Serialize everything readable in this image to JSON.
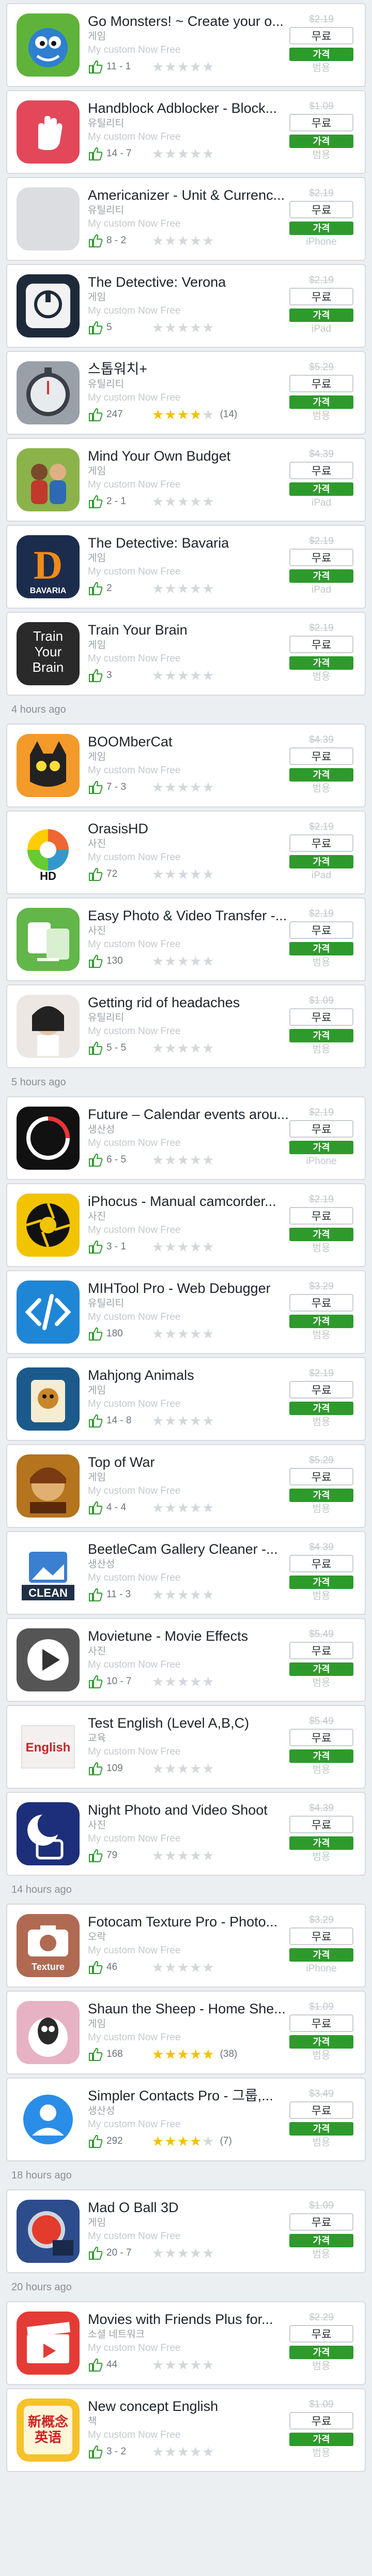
{
  "colors": {
    "accent_green": "#2e9a2c",
    "star_on": "#f2c200",
    "star_off": "#d4d7db"
  },
  "common": {
    "custom_label": "My custom Now Free",
    "free_label": "무료",
    "price_label": "가격"
  },
  "sections": [
    {
      "header": "",
      "apps": [
        {
          "title": "Go Monsters! ~ Create your o...",
          "category": "게임",
          "old_price": "$2.19",
          "likes": "11 - 1",
          "rating": 0,
          "rating_count": "",
          "device": "범용",
          "icon": "monster-icon",
          "icon_color": "#5fb33a"
        },
        {
          "title": "Handblock Adblocker - Block...",
          "category": "유틸리티",
          "old_price": "$1.09",
          "likes": "14 - 7",
          "rating": 0,
          "rating_count": "",
          "device": "범용",
          "icon": "hand-icon",
          "icon_color": "#e2485a"
        },
        {
          "title": "Americanizer - Unit & Currenc...",
          "category": "유틸리티",
          "old_price": "$2.19",
          "likes": "8 - 2",
          "rating": 0,
          "rating_count": "",
          "device": "iPhone",
          "icon": "placeholder-icon",
          "icon_color": "#dcdde0"
        },
        {
          "title": "The Detective: Verona",
          "category": "게임",
          "old_price": "$2.19",
          "likes": "5",
          "rating": 0,
          "rating_count": "",
          "device": "iPad",
          "icon": "detective-icon",
          "icon_color": "#1e2a3a"
        },
        {
          "title": "스톱워치+",
          "category": "유틸리티",
          "old_price": "$5.29",
          "likes": "247",
          "rating": 4,
          "rating_count": "(14)",
          "device": "범용",
          "icon": "stopwatch-icon",
          "icon_color": "#3a3f47"
        },
        {
          "title": "Mind Your Own Budget",
          "category": "게임",
          "old_price": "$4.39",
          "likes": "2 - 1",
          "rating": 0,
          "rating_count": "",
          "device": "iPad",
          "icon": "people-icon",
          "icon_color": "#8bb34a"
        },
        {
          "title": "The Detective: Bavaria",
          "category": "게임",
          "old_price": "$2.19",
          "likes": "2",
          "rating": 0,
          "rating_count": "",
          "device": "iPad",
          "icon": "detective-d-icon",
          "icon_color": "#1c2c4c"
        },
        {
          "title": "Train Your Brain",
          "category": "게임",
          "old_price": "$2.19",
          "likes": "3",
          "rating": 0,
          "rating_count": "",
          "device": "범용",
          "icon": "brain-text-icon",
          "icon_color": "#2a2a2a",
          "icon_text": "Train\nYour\nBrain"
        }
      ]
    },
    {
      "header": "4 hours ago",
      "apps": [
        {
          "title": "BOOMberCat",
          "category": "게임",
          "old_price": "$4.39",
          "likes": "7 - 3",
          "rating": 0,
          "rating_count": "",
          "device": "범용",
          "icon": "cat-icon",
          "icon_color": "#f39a2a"
        },
        {
          "title": "OrasisHD",
          "category": "사진",
          "old_price": "$2.19",
          "likes": "72",
          "rating": 0,
          "rating_count": "",
          "device": "iPad",
          "icon": "orasis-icon",
          "icon_color": "#ffffff",
          "icon_text": "HD"
        },
        {
          "title": "Easy Photo & Video Transfer -...",
          "category": "사진",
          "old_price": "$2.19",
          "likes": "130",
          "rating": 0,
          "rating_count": "",
          "device": "범용",
          "icon": "transfer-icon",
          "icon_color": "#62b64a"
        },
        {
          "title": "Getting rid of headaches",
          "category": "유틸리티",
          "old_price": "$1.09",
          "likes": "5 - 5",
          "rating": 0,
          "rating_count": "",
          "device": "범용",
          "icon": "headache-icon",
          "icon_color": "#c9b8a8"
        }
      ]
    },
    {
      "header": "5 hours ago",
      "apps": [
        {
          "title": "Future – Calendar events arou...",
          "category": "생산성",
          "old_price": "$2.19",
          "likes": "6 - 5",
          "rating": 0,
          "rating_count": "",
          "device": "iPhone",
          "icon": "future-icon",
          "icon_color": "#111111"
        },
        {
          "title": "iPhocus - Manual camcorder...",
          "category": "사진",
          "old_price": "$2.19",
          "likes": "3 - 1",
          "rating": 0,
          "rating_count": "",
          "device": "범용",
          "icon": "aperture-icon",
          "icon_color": "#f2c400"
        },
        {
          "title": "MIHTool Pro - Web Debugger",
          "category": "유틸리티",
          "old_price": "$3.29",
          "likes": "180",
          "rating": 0,
          "rating_count": "",
          "device": "범용",
          "icon": "code-icon",
          "icon_color": "#1f86d6"
        },
        {
          "title": "Mahjong Animals",
          "category": "게임",
          "old_price": "$2.19",
          "likes": "14 - 8",
          "rating": 0,
          "rating_count": "",
          "device": "범용",
          "icon": "mahjong-icon",
          "icon_color": "#1c5a8c"
        },
        {
          "title": "Top of War",
          "category": "게임",
          "old_price": "$5.29",
          "likes": "4 - 4",
          "rating": 0,
          "rating_count": "",
          "device": "범용",
          "icon": "warrior-icon",
          "icon_color": "#b5741e"
        },
        {
          "title": "BeetleCam Gallery Cleaner -...",
          "category": "생산성",
          "old_price": "$4.39",
          "likes": "11 - 3",
          "rating": 0,
          "rating_count": "",
          "device": "범용",
          "icon": "clean-icon",
          "icon_color": "#ffffff",
          "icon_text": "CLEAN"
        },
        {
          "title": "Movietune - Movie Effects",
          "category": "사진",
          "old_price": "$5.49",
          "likes": "10 - 7",
          "rating": 0,
          "rating_count": "",
          "device": "범용",
          "icon": "play-icon",
          "icon_color": "#555555"
        },
        {
          "title": "Test English (Level A,B,C)",
          "category": "교육",
          "old_price": "$5.49",
          "likes": "109",
          "rating": 0,
          "rating_count": "",
          "device": "범용",
          "icon": "english-icon",
          "icon_color": "#ffffff",
          "icon_text": "English"
        },
        {
          "title": "Night Photo and Video Shoot",
          "category": "사진",
          "old_price": "$4.39",
          "likes": "79",
          "rating": 0,
          "rating_count": "",
          "device": "범용",
          "icon": "night-icon",
          "icon_color": "#1d2f7a"
        }
      ]
    },
    {
      "header": "14 hours ago",
      "apps": [
        {
          "title": "Fotocam Texture Pro - Photo...",
          "category": "오락",
          "old_price": "$3.29",
          "likes": "46",
          "rating": 0,
          "rating_count": "",
          "device": "iPhone",
          "icon": "camera-icon",
          "icon_color": "#b06a52",
          "icon_text": "Texture"
        },
        {
          "title": "Shaun the Sheep - Home She...",
          "category": "게임",
          "old_price": "$1.09",
          "likes": "168",
          "rating": 5,
          "rating_count": "(38)",
          "device": "범용",
          "icon": "sheep-icon",
          "icon_color": "#e7b2c4"
        },
        {
          "title": "Simpler Contacts Pro - 그룹,...",
          "category": "생산성",
          "old_price": "$3.49",
          "likes": "292",
          "rating": 4,
          "rating_count": "(7)",
          "device": "범용",
          "icon": "contact-icon",
          "icon_color": "#2a8de8"
        }
      ]
    },
    {
      "header": "18 hours ago",
      "apps": [
        {
          "title": "Mad O Ball 3D",
          "category": "게임",
          "old_price": "$1.09",
          "likes": "20 - 7",
          "rating": 0,
          "rating_count": "",
          "device": "범용",
          "icon": "ball-icon",
          "icon_color": "#2d4c8c"
        }
      ]
    },
    {
      "header": "20 hours ago",
      "apps": [
        {
          "title": "Movies with Friends Plus for...",
          "category": "소셜 네트워크",
          "old_price": "$2.29",
          "likes": "44",
          "rating": 0,
          "rating_count": "",
          "device": "범용",
          "icon": "clapper-icon",
          "icon_color": "#e43b36"
        },
        {
          "title": "New concept English",
          "category": "책",
          "old_price": "$1.09",
          "likes": "3 - 2",
          "rating": 0,
          "rating_count": "",
          "device": "범용",
          "icon": "book-icon",
          "icon_color": "#f6c12a",
          "icon_text": "新概念\n英语"
        }
      ]
    }
  ]
}
